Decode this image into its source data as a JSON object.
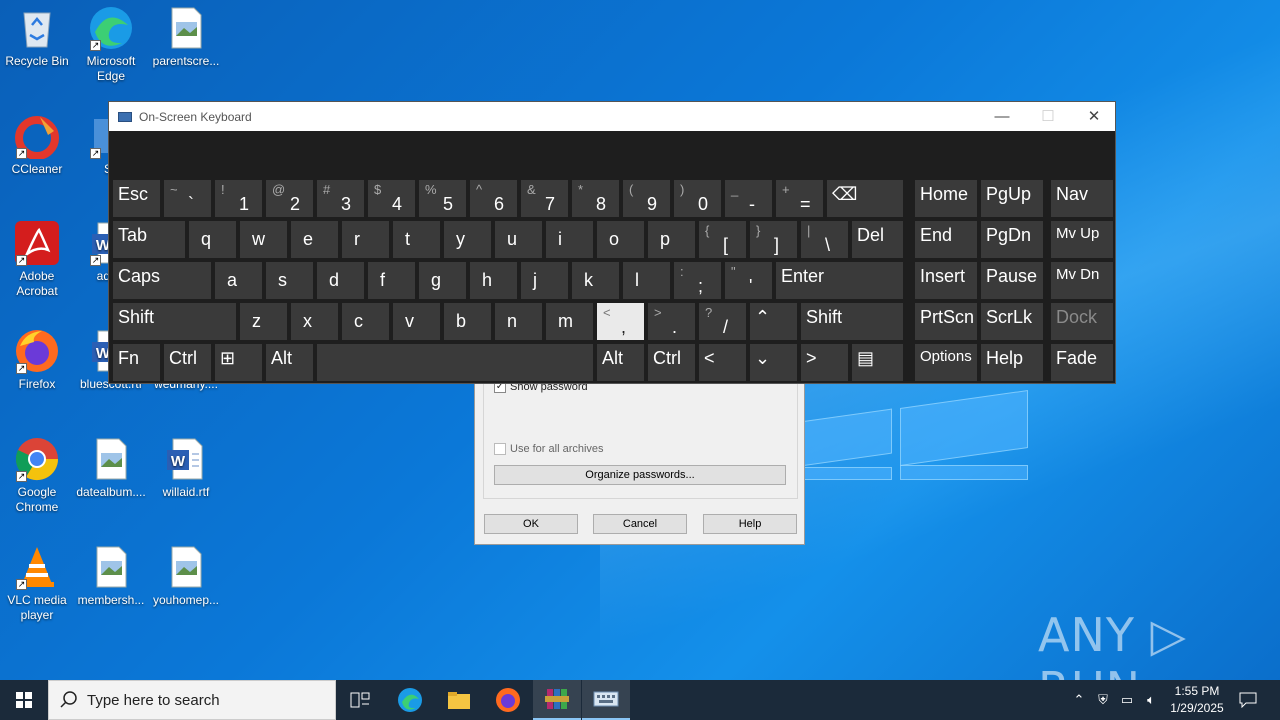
{
  "desktop": {
    "icons": [
      {
        "label": "Recycle Bin",
        "icon": "recycle-bin-icon"
      },
      {
        "label": "Microsoft Edge",
        "icon": "edge-icon"
      },
      {
        "label": "parentscre...",
        "icon": "image-file-icon"
      },
      {
        "label": "CCleaner",
        "icon": "ccleaner-icon"
      },
      {
        "label": "Sk",
        "icon": "shortcut-icon"
      },
      {
        "label": "Adobe Acrobat",
        "icon": "acrobat-icon"
      },
      {
        "label": "additi",
        "icon": "word-doc-icon"
      },
      {
        "label": "Firefox",
        "icon": "firefox-icon"
      },
      {
        "label": "bluescott.rtf",
        "icon": "word-doc-icon"
      },
      {
        "label": "wedmany....",
        "icon": "word-doc-icon"
      },
      {
        "label": "Google Chrome",
        "icon": "chrome-icon"
      },
      {
        "label": "datealbum....",
        "icon": "image-file-icon"
      },
      {
        "label": "willaid.rtf",
        "icon": "word-doc-icon"
      },
      {
        "label": "VLC media player",
        "icon": "vlc-icon"
      },
      {
        "label": "membersh...",
        "icon": "image-file-icon"
      },
      {
        "label": "youhomep...",
        "icon": "image-file-icon"
      }
    ]
  },
  "dialog": {
    "show_password": "Show password",
    "use_for_all": "Use for all archives",
    "organize": "Organize passwords...",
    "ok": "OK",
    "cancel": "Cancel",
    "help": "Help"
  },
  "osk": {
    "title": "On-Screen Keyboard",
    "minimize": "—",
    "maximize": "☐",
    "close": "✕",
    "row1": [
      {
        "label": "Esc"
      },
      {
        "shift": "~",
        "main": "`"
      },
      {
        "shift": "!",
        "main": "1"
      },
      {
        "shift": "@",
        "main": "2"
      },
      {
        "shift": "#",
        "main": "3"
      },
      {
        "shift": "$",
        "main": "4"
      },
      {
        "shift": "%",
        "main": "5"
      },
      {
        "shift": "^",
        "main": "6"
      },
      {
        "shift": "&",
        "main": "7"
      },
      {
        "shift": "*",
        "main": "8"
      },
      {
        "shift": "(",
        "main": "9"
      },
      {
        "shift": ")",
        "main": "0"
      },
      {
        "shift": "_",
        "main": "-"
      },
      {
        "shift": "+",
        "main": "="
      },
      {
        "label": "⌫"
      }
    ],
    "row2": [
      {
        "label": "Tab"
      },
      {
        "label": "q"
      },
      {
        "label": "w"
      },
      {
        "label": "e"
      },
      {
        "label": "r"
      },
      {
        "label": "t"
      },
      {
        "label": "y"
      },
      {
        "label": "u"
      },
      {
        "label": "i"
      },
      {
        "label": "o"
      },
      {
        "label": "p"
      },
      {
        "shift": "{",
        "main": "["
      },
      {
        "shift": "}",
        "main": "]"
      },
      {
        "shift": "|",
        "main": "\\"
      },
      {
        "label": "Del"
      }
    ],
    "row3": [
      {
        "label": "Caps"
      },
      {
        "label": "a"
      },
      {
        "label": "s"
      },
      {
        "label": "d"
      },
      {
        "label": "f"
      },
      {
        "label": "g"
      },
      {
        "label": "h"
      },
      {
        "label": "j"
      },
      {
        "label": "k"
      },
      {
        "label": "l"
      },
      {
        "shift": ":",
        "main": ";"
      },
      {
        "shift": "\"",
        "main": "'"
      },
      {
        "label": "Enter"
      }
    ],
    "row4": [
      {
        "label": "Shift"
      },
      {
        "label": "z"
      },
      {
        "label": "x"
      },
      {
        "label": "c"
      },
      {
        "label": "v"
      },
      {
        "label": "b"
      },
      {
        "label": "n"
      },
      {
        "label": "m"
      },
      {
        "shift": "<",
        "main": ","
      },
      {
        "shift": ">",
        "main": "."
      },
      {
        "shift": "?",
        "main": "/"
      },
      {
        "label": "⌃"
      },
      {
        "label": "Shift"
      }
    ],
    "row5": [
      {
        "label": "Fn"
      },
      {
        "label": "Ctrl"
      },
      {
        "label": "⊞"
      },
      {
        "label": "Alt"
      },
      {
        "label": ""
      },
      {
        "label": "Alt"
      },
      {
        "label": "Ctrl"
      },
      {
        "label": "<"
      },
      {
        "label": "⌄"
      },
      {
        "label": ">"
      },
      {
        "label": "▤"
      }
    ],
    "nav": [
      [
        "Home",
        "PgUp",
        "Nav"
      ],
      [
        "End",
        "PgDn",
        "Mv Up"
      ],
      [
        "Insert",
        "Pause",
        "Mv Dn"
      ],
      [
        "PrtScn",
        "ScrLk",
        "Dock"
      ],
      [
        "Options",
        "Help",
        "Fade"
      ]
    ]
  },
  "watermark": "ANY ▷ RUN",
  "taskbar": {
    "search_placeholder": "Type here to search",
    "time": "1:55 PM",
    "date": "1/29/2025",
    "tray_icons": [
      "chevron-up-icon",
      "security-icon",
      "network-icon",
      "volume-icon"
    ]
  }
}
